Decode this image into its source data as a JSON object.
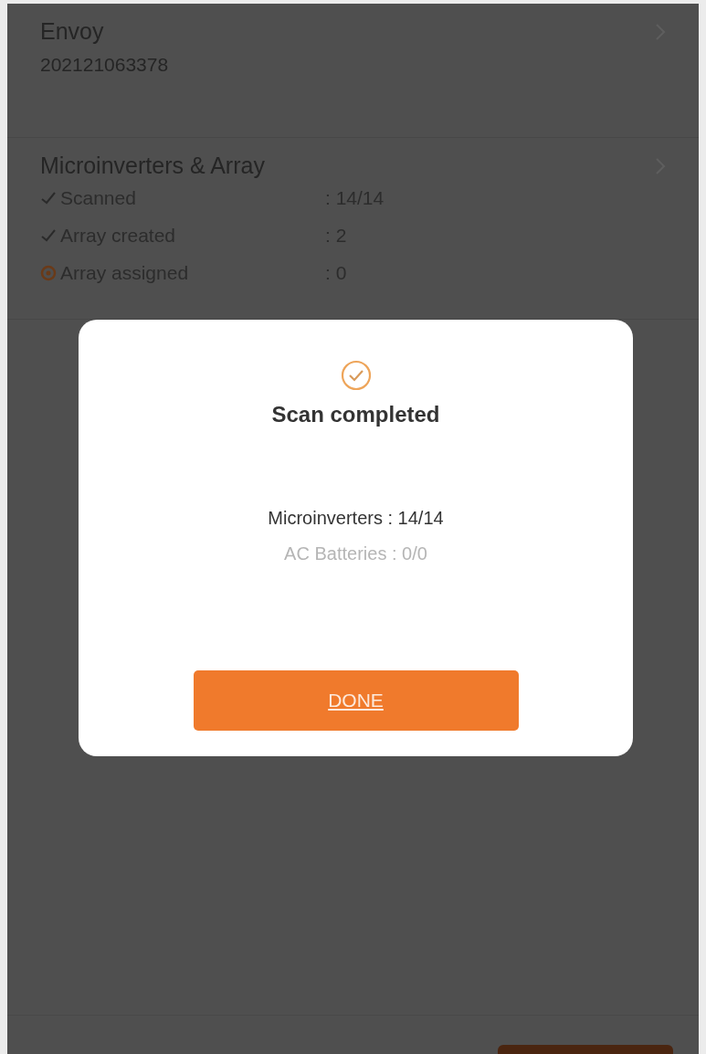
{
  "sections": [
    {
      "title": "Envoy",
      "subtitle": "202121063378"
    },
    {
      "title": "Microinverters & Array",
      "items": [
        {
          "label": "Scanned",
          "value": ": 14/14",
          "kind": "done"
        },
        {
          "label": "Array created",
          "value": ": 2",
          "kind": "done"
        },
        {
          "label": "Array assigned",
          "value": ": 0",
          "kind": "pending"
        }
      ]
    }
  ],
  "dialog": {
    "title": "Scan completed",
    "lines": [
      {
        "text": "Microinverters : 14/14",
        "dimmed": false
      },
      {
        "text": "AC Batteries : 0/0",
        "dimmed": true
      }
    ],
    "button": "DONE"
  }
}
